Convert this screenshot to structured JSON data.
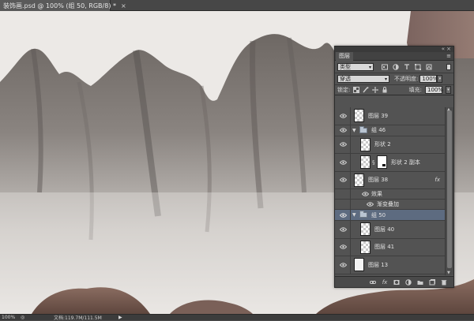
{
  "document": {
    "tab_title": "装饰画.psd @ 100% (组 50, RGB/8) *",
    "close_glyph": "×"
  },
  "status": {
    "zoom": "100%",
    "doc_info": "文档:119.7M/111.5M",
    "arrow_glyph": "▶"
  },
  "layers_panel": {
    "tab": "图层",
    "collapse_glyph": "«",
    "close_glyph": "×",
    "menu_glyph": "≡",
    "filter_kind": "类型",
    "blend_mode": "穿透",
    "opacity_label": "不透明度:",
    "opacity_value": "100%",
    "lock_label": "锁定:",
    "fill_label": "填充:",
    "fill_value": "100%",
    "layers": [
      {
        "name": "图层 39",
        "kind": "layer",
        "indent": 0
      },
      {
        "name": "组 46",
        "kind": "group",
        "expanded": true,
        "indent": 0
      },
      {
        "name": "形状 2",
        "kind": "layer",
        "indent": 1
      },
      {
        "name": "形状 2 副本",
        "kind": "layer-mask",
        "indent": 1
      },
      {
        "name": "图层 38",
        "kind": "layer",
        "indent": 0,
        "fx": "fx"
      },
      {
        "name": "效果",
        "kind": "effects",
        "indent": 0
      },
      {
        "name": "渐变叠加",
        "kind": "effect",
        "indent": 0
      },
      {
        "name": "组 50",
        "kind": "group",
        "expanded": true,
        "indent": 0,
        "selected": true
      },
      {
        "name": "图层 40",
        "kind": "layer",
        "indent": 1
      },
      {
        "name": "图层 41",
        "kind": "layer",
        "indent": 1
      },
      {
        "name": "图层 13",
        "kind": "layer-white",
        "indent": 0
      }
    ],
    "bottom_icons": [
      "link-icon",
      "fx-icon",
      "mask-icon",
      "adjustment-icon",
      "folder-icon",
      "new-layer-icon",
      "trash-icon"
    ]
  },
  "colors": {
    "panel_bg": "#535353",
    "selected_row": "#5d6b80",
    "canvas_bg": "#ece9e6"
  }
}
